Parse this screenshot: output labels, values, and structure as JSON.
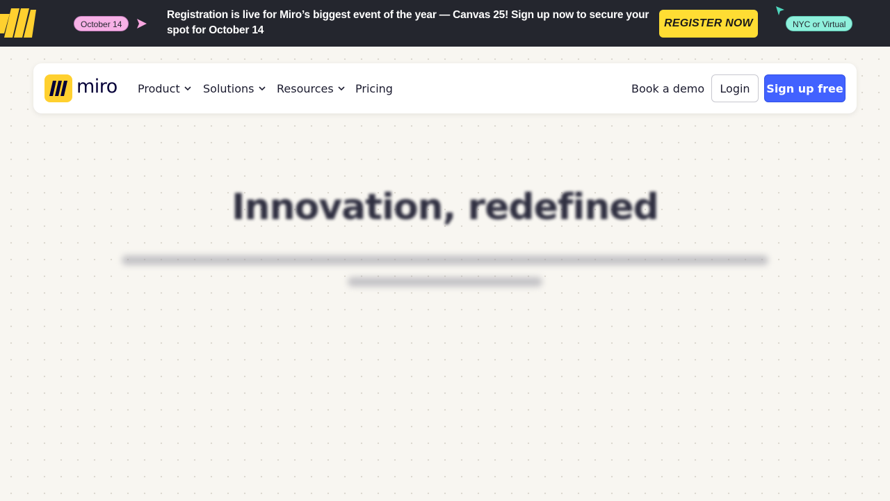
{
  "banner": {
    "date_badge": "October 14",
    "message": "Registration is live for Miro’s biggest event of the year — Canvas 25! Sign up now to secure your spot for October 14",
    "cta_label": "REGISTER NOW",
    "location_badge": "NYC or Virtual",
    "colors": {
      "background": "#24262e",
      "cta": "#ffdd33",
      "date_pill": "#f7b1e6",
      "location_pill": "#8ff0dc"
    }
  },
  "nav": {
    "brand": "miro",
    "items": [
      {
        "label": "Product",
        "has_dropdown": true
      },
      {
        "label": "Solutions",
        "has_dropdown": true
      },
      {
        "label": "Resources",
        "has_dropdown": true
      },
      {
        "label": "Pricing",
        "has_dropdown": false
      }
    ],
    "book_demo": "Book a demo",
    "login": "Login",
    "signup": "Sign up free",
    "colors": {
      "signup": "#4262ff",
      "logo_bg": "#ffd02f"
    }
  },
  "hero": {
    "title": "Innovation, redefined",
    "subtitle": ""
  }
}
